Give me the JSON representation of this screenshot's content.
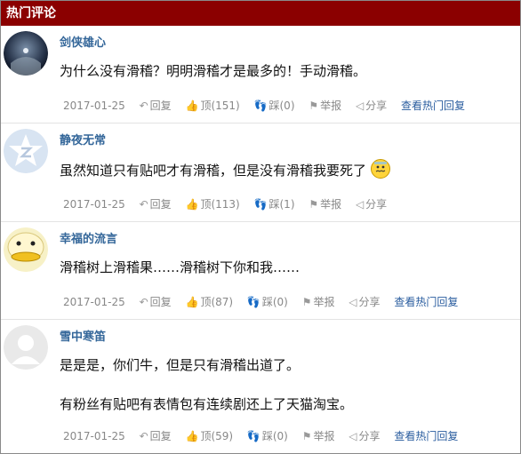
{
  "header": {
    "title": "热门评论"
  },
  "comments": [
    {
      "user": "剑侠雄心",
      "lines": [
        "为什么没有滑稽？明明滑稽才是最多的！手动滑稽。"
      ],
      "date": "2017-01-25",
      "reply_label": "回复",
      "like_label": "顶(151)",
      "dislike_label": "踩(0)",
      "report_label": "举报",
      "share_label": "分享",
      "hot_reply_label": "查看热门回复",
      "avatar_icon": "space-earth-avatar-icon"
    },
    {
      "user": "静夜无常",
      "lines": [
        "虽然知道只有贴吧才有滑稽，但是没有滑稽我要死了"
      ],
      "date": "2017-01-25",
      "reply_label": "回复",
      "like_label": "顶(113)",
      "dislike_label": "踩(1)",
      "report_label": "举报",
      "share_label": "分享",
      "avatar_icon": "star-logo-avatar-icon",
      "emoji_icon": "nervous-emoji-icon"
    },
    {
      "user": "幸福的流言",
      "lines": [
        "滑稽树上滑稽果……滑稽树下你和我……"
      ],
      "date": "2017-01-25",
      "reply_label": "回复",
      "like_label": "顶(87)",
      "dislike_label": "踩(0)",
      "report_label": "举报",
      "share_label": "分享",
      "hot_reply_label": "查看热门回复",
      "avatar_icon": "duck-cartoon-avatar-icon"
    },
    {
      "user": "雪中寒笛",
      "lines": [
        "是是是，你们牛，但是只有滑稽出道了。",
        "有粉丝有贴吧有表情包有连续剧还上了天猫淘宝。"
      ],
      "date": "2017-01-25",
      "reply_label": "回复",
      "like_label": "顶(59)",
      "dislike_label": "踩(0)",
      "report_label": "举报",
      "share_label": "分享",
      "hot_reply_label": "查看热门回复",
      "avatar_icon": "default-user-avatar-icon"
    }
  ],
  "colors": {
    "header_bg": "#8b0000",
    "username": "#336699",
    "hot_reply_link": "#2a5d9f"
  }
}
